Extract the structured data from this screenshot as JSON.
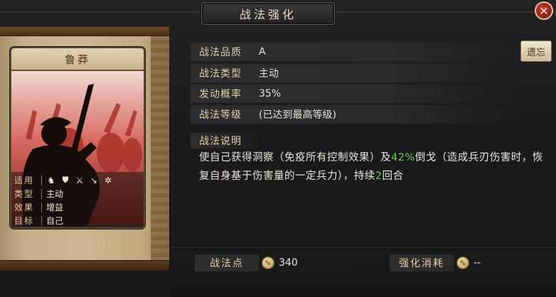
{
  "header": {
    "title": "战法强化",
    "close_label": "✕"
  },
  "skill_card": {
    "name": "鲁莽",
    "rows": [
      {
        "label": "适用",
        "value": "",
        "icons": [
          "cavalry-icon",
          "shield-icon",
          "bow-icon",
          "spear-icon",
          "wheel-icon"
        ]
      },
      {
        "label": "类型",
        "value": "主动"
      },
      {
        "label": "效果",
        "value": "增益"
      },
      {
        "label": "目标",
        "value": "自己"
      }
    ]
  },
  "attributes": [
    {
      "label": "战法品质",
      "value": "A"
    },
    {
      "label": "战法类型",
      "value": "主动"
    },
    {
      "label": "发动概率",
      "value": "35%"
    },
    {
      "label": "战法等级",
      "value": "(已达到最高等级)"
    }
  ],
  "inherit_button": "遗忘",
  "description": {
    "label": "战法说明",
    "text_1": "使自己获得洞察（免疫所有控制效果）及",
    "highlight_1": "42%",
    "text_2": "倒戈（造成兵刃伤害时，恢复自身基于伤害量的一定兵力），持续",
    "highlight_2": "2",
    "text_3": "回合"
  },
  "footer": {
    "points_label": "战法点",
    "points_value": "340",
    "cost_label": "强化消耗",
    "cost_value": "--"
  },
  "colors": {
    "highlight": "#6ad14a",
    "label_gold": "#e4cfa4",
    "close_red": "#c23b32"
  }
}
